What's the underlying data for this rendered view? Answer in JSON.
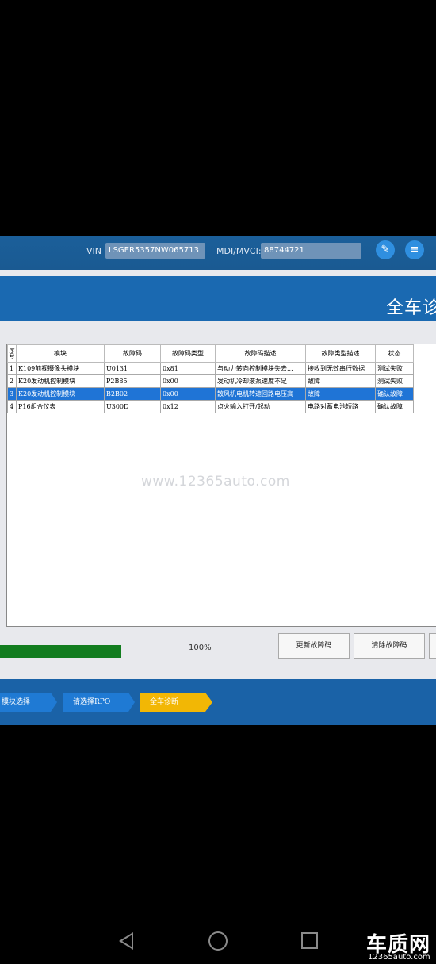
{
  "top_bar": {
    "vin_label": "VIN",
    "vin_value": "LSGER5357NW065713",
    "mdi_label": "MDI/MVCI:",
    "mdi_value": "88744721",
    "icon1": "edit-icon",
    "icon2": "report-icon"
  },
  "page_title": "全车诊",
  "table": {
    "headers": [
      "序号",
      "模块",
      "故障码",
      "故障码类型",
      "故障码描述",
      "故障类型描述",
      "状态"
    ],
    "rows": [
      [
        "1",
        "K109前视摄像头模块",
        "U0131",
        "0x81",
        "与动力转向控制模块失去...",
        "接收到无效串行数据",
        "测试失败"
      ],
      [
        "2",
        "K20发动机控制模块",
        "P2B85",
        "0x00",
        "发动机冷却液泵速度不足",
        "故障",
        "测试失败"
      ],
      [
        "3",
        "K20发动机控制模块",
        "B2B02",
        "0x00",
        "散风机电机转速回路电压高",
        "故障",
        "确认故障"
      ],
      [
        "4",
        "P16组合仪表",
        "U300D",
        "0x12",
        "点火输入打开/起动",
        "电路对蓄电池短路",
        "确认故障"
      ]
    ],
    "selected_row": 2
  },
  "watermark": "www.12365auto.com",
  "progress": {
    "value": 1.0,
    "text": "100%"
  },
  "buttons": {
    "update": "更新故障码",
    "clear": "清除故障码"
  },
  "steps": [
    {
      "label": "模块选择"
    },
    {
      "label": "请选择RPO"
    },
    {
      "label": "全车诊断",
      "active": true
    }
  ],
  "colors": {
    "step_active": "#f2b705",
    "step_inactive": "#1f7ad4",
    "selected_row": "#1f74d6",
    "progress": "#127d1f"
  },
  "logo": {
    "main": "车质网",
    "sub": "12365auto.com"
  }
}
